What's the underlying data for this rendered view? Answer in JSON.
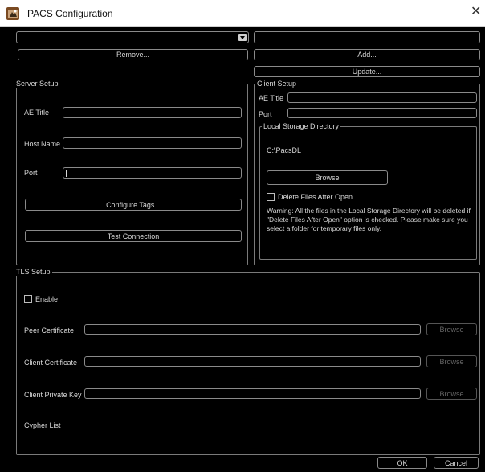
{
  "window": {
    "title": "PACS Configuration",
    "close_icon": "close-icon"
  },
  "top": {
    "server_select_value": "",
    "client_field_value": "",
    "remove_label": "Remove...",
    "add_label": "Add...",
    "update_label": "Update..."
  },
  "server_setup": {
    "title": "Server Setup",
    "ae_title_label": "AE Title",
    "ae_title_value": "",
    "host_name_label": "Host Name",
    "host_name_value": "",
    "port_label": "Port",
    "port_value": "",
    "configure_tags_label": "Configure Tags...",
    "test_connection_label": "Test Connection"
  },
  "client_setup": {
    "title": "Client Setup",
    "ae_title_label": "AE Title",
    "ae_title_value": "",
    "port_label": "Port",
    "port_value": "",
    "local_storage": {
      "title": "Local Storage Directory",
      "path": "C:\\PacsDL",
      "browse_label": "Browse",
      "delete_after_open_label": "Delete Files After Open",
      "delete_after_open_checked": false,
      "warning": "Warning: All the files in the Local Storage Directory will be deleted if \"Delete Files After Open\" option is checked. Please make sure you select a folder for temporary files only."
    }
  },
  "tls_setup": {
    "title": "TLS Setup",
    "enable_label": "Enable",
    "enable_checked": false,
    "peer_certificate_label": "Peer Certificate",
    "peer_certificate_value": "",
    "client_certificate_label": "Client Certificate",
    "client_certificate_value": "",
    "client_private_key_label": "Client Private Key",
    "client_private_key_value": "",
    "cypher_list_label": "Cypher List",
    "browse_label": "Browse"
  },
  "footer": {
    "ok_label": "OK",
    "cancel_label": "Cancel"
  }
}
